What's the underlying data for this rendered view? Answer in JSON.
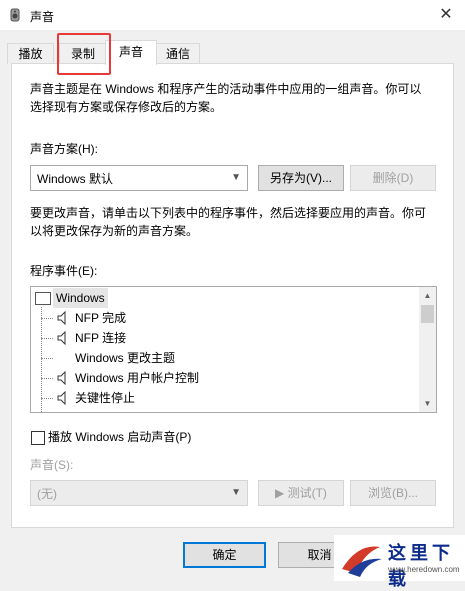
{
  "window": {
    "title": "声音",
    "close_symbol": "✕"
  },
  "tabs": [
    {
      "label": "播放"
    },
    {
      "label": "录制"
    },
    {
      "label": "声音"
    },
    {
      "label": "通信"
    }
  ],
  "description": {
    "line1": "声音主题是在 Windows 和程序产生的活动事件中应用的一组声音。你可以",
    "line2": "选择现有方案或保存修改后的方案。"
  },
  "scheme": {
    "label": "声音方案(H):",
    "value": "Windows 默认",
    "save_as": "另存为(V)...",
    "delete": "删除(D)"
  },
  "instruction": {
    "line1": "要更改声音，请单击以下列表中的程序事件，然后选择要应用的声音。你可",
    "line2": "以将更改保存为新的声音方案。"
  },
  "events": {
    "label": "程序事件(E):",
    "items": [
      {
        "label": "Windows",
        "icon": "window-icon"
      },
      {
        "label": "NFP 完成",
        "icon": "speaker-icon"
      },
      {
        "label": "NFP 连接",
        "icon": "speaker-icon"
      },
      {
        "label": "Windows 更改主题",
        "icon": ""
      },
      {
        "label": "Windows 用户帐户控制",
        "icon": "speaker-icon"
      },
      {
        "label": "关键性停止",
        "icon": "speaker-icon"
      }
    ]
  },
  "startup": {
    "label": "播放 Windows 启动声音(P)",
    "checked": false
  },
  "sound": {
    "label": "声音(S):",
    "value": "(无)",
    "test": "测试(T)",
    "browse": "浏览(B)..."
  },
  "footer": {
    "ok": "确定",
    "cancel": "取消"
  },
  "watermark": {
    "text": "这里下载",
    "url": "www.heredown.com"
  }
}
